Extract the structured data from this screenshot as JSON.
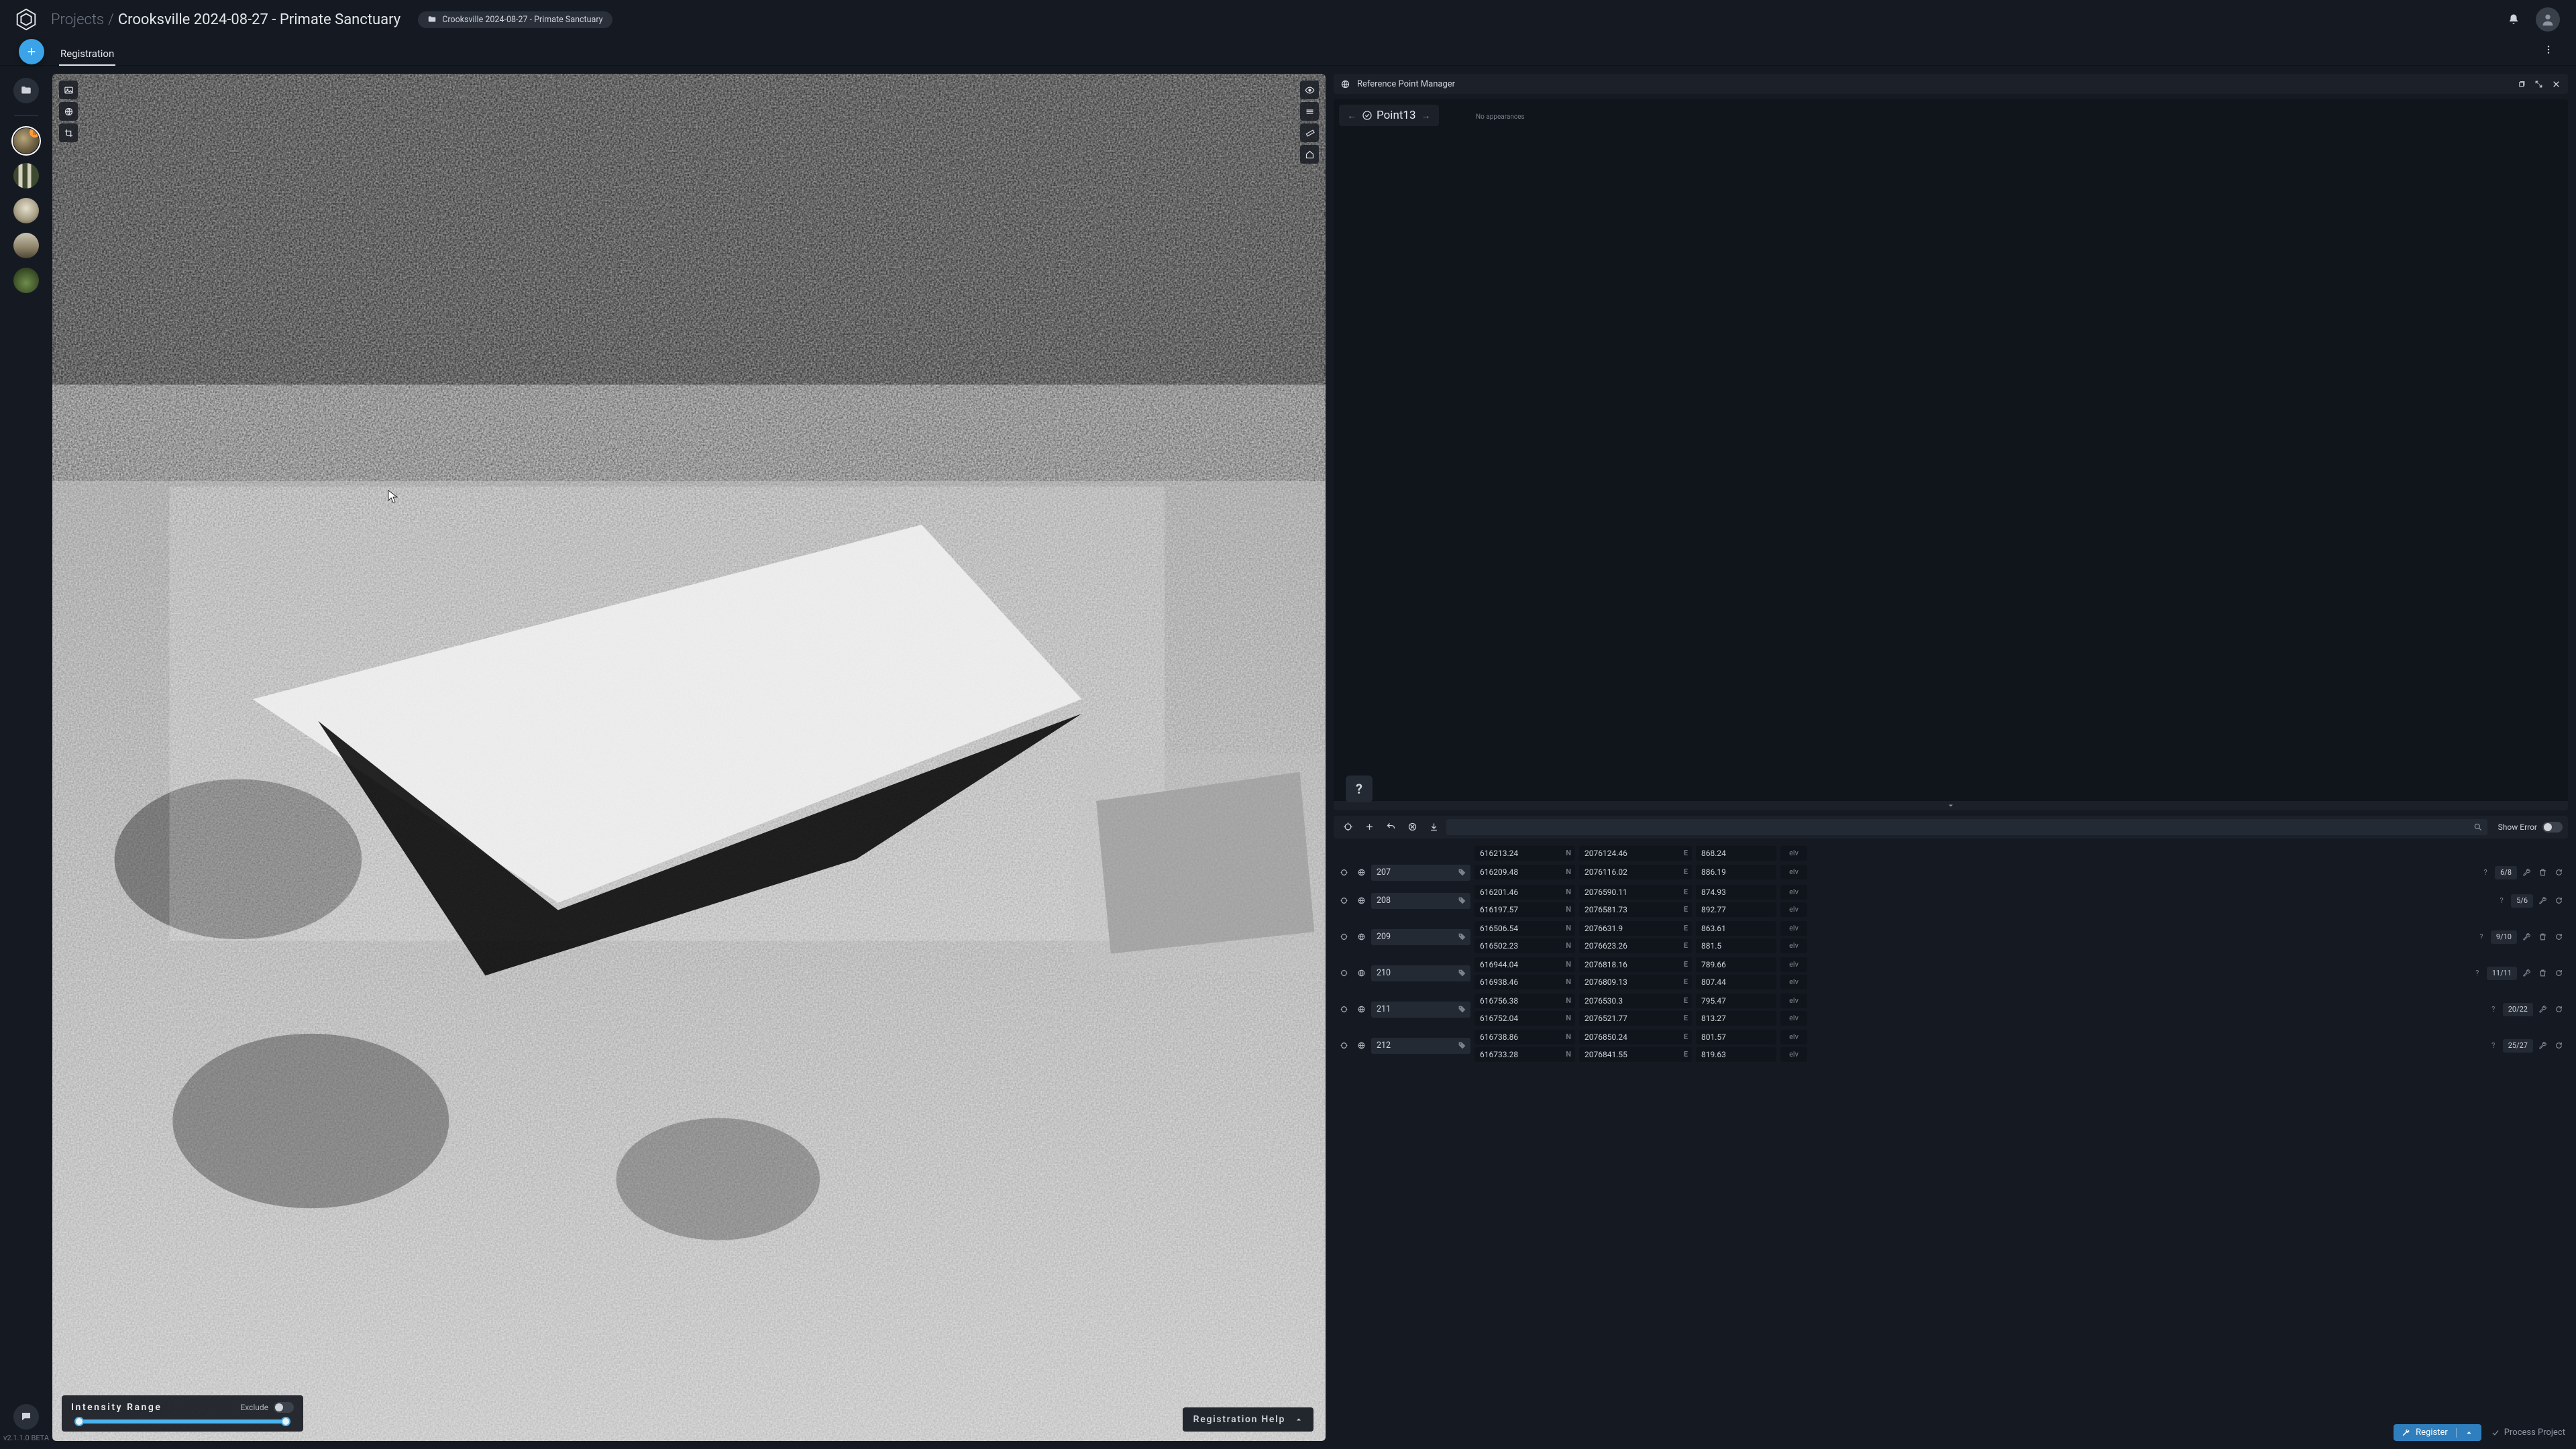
{
  "app": {
    "breadcrumb_root": "Projects",
    "breadcrumb_sep": "/",
    "breadcrumb_leaf": "Crooksville 2024-08-27 - Primate Sanctuary",
    "chip_label": "Crooksville 2024-08-27 - Primate Sanctuary",
    "version": "v2.1.1.0 BETA"
  },
  "tabs": {
    "active": "Registration"
  },
  "rail": {
    "thumbs": [
      {
        "badge": "||"
      },
      {},
      {},
      {},
      {}
    ]
  },
  "viewport": {
    "intensity_title": "Intensity Range",
    "exclude_label": "Exclude",
    "help_label": "Registration Help"
  },
  "rpm": {
    "title": "Reference Point Manager",
    "point_name": "Point13",
    "sub_label": "No appearances",
    "help": "?",
    "show_error": "Show Error",
    "register": "Register",
    "process": "Process Project"
  },
  "points": [
    {
      "id": "207",
      "count": "6/8",
      "showDelete": true,
      "partialAbove": {
        "N": "616213.24",
        "E": "2076124.46",
        "Z": "868.24"
      },
      "coords": [
        {
          "N": "616209.48",
          "E": "2076116.02",
          "Z": "886.19"
        }
      ]
    },
    {
      "id": "208",
      "count": "5/6",
      "showDelete": false,
      "coords": [
        {
          "N": "616201.46",
          "E": "2076590.11",
          "Z": "874.93"
        },
        {
          "N": "616197.57",
          "E": "2076581.73",
          "Z": "892.77"
        }
      ]
    },
    {
      "id": "209",
      "count": "9/10",
      "showDelete": true,
      "coords": [
        {
          "N": "616506.54",
          "E": "2076631.9",
          "Z": "863.61"
        },
        {
          "N": "616502.23",
          "E": "2076623.26",
          "Z": "881.5"
        }
      ]
    },
    {
      "id": "210",
      "count": "11/11",
      "showDelete": true,
      "coords": [
        {
          "N": "616944.04",
          "E": "2076818.16",
          "Z": "789.66"
        },
        {
          "N": "616938.46",
          "E": "2076809.13",
          "Z": "807.44"
        }
      ]
    },
    {
      "id": "211",
      "count": "20/22",
      "showDelete": false,
      "coords": [
        {
          "N": "616756.38",
          "E": "2076530.3",
          "Z": "795.47"
        },
        {
          "N": "616752.04",
          "E": "2076521.77",
          "Z": "813.27"
        }
      ]
    },
    {
      "id": "212",
      "count": "25/27",
      "showDelete": false,
      "coords": [
        {
          "N": "616738.86",
          "E": "2076850.24",
          "Z": "801.57"
        },
        {
          "N": "616733.28",
          "E": "2076841.55",
          "Z": "819.63"
        }
      ]
    }
  ]
}
